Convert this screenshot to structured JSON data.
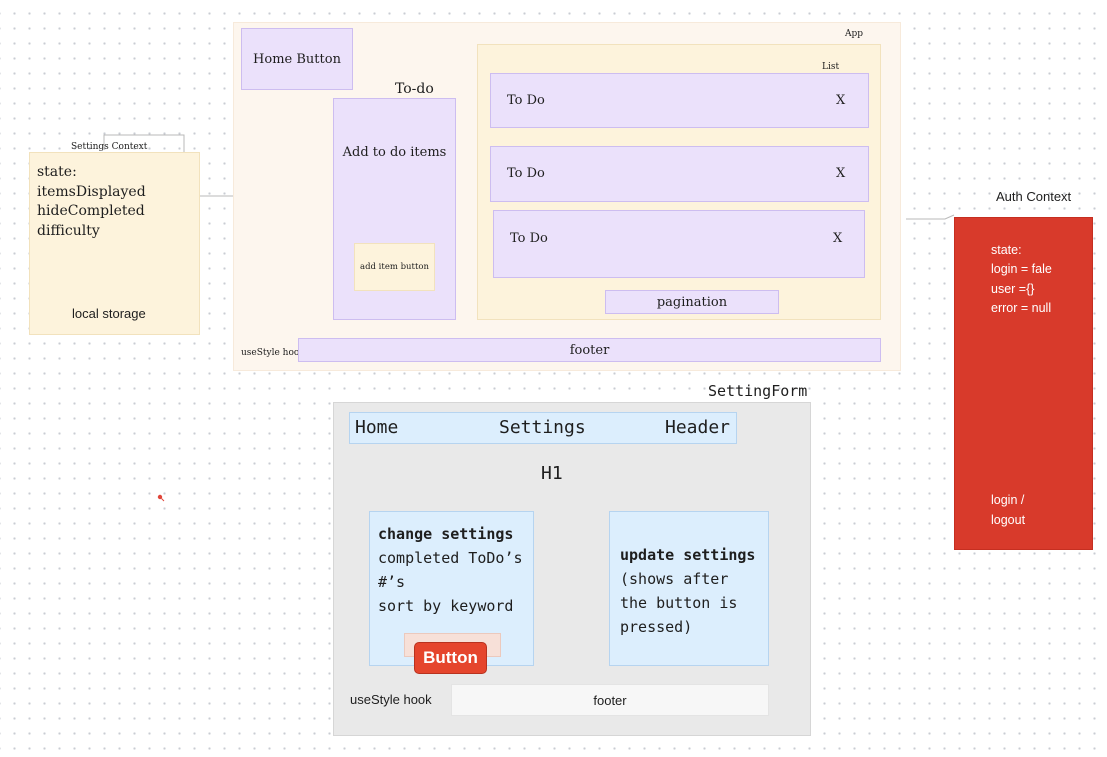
{
  "settings_context": {
    "label": "Settings Context",
    "state_lines": [
      "state:",
      "itemsDisplayed",
      "hideCompleted",
      "difficulty"
    ],
    "storage": "local storage"
  },
  "app": {
    "label": "App",
    "home_button": "Home Button",
    "todo_title": "To-do",
    "add_items": "Add to do items",
    "add_item_button": "add item button",
    "list_label": "List",
    "todos": [
      {
        "text": "To Do",
        "close": "X"
      },
      {
        "text": "To Do",
        "close": "X"
      },
      {
        "text": "To Do",
        "close": "X"
      }
    ],
    "pagination": "pagination",
    "use_style": "useStyle hook",
    "footer": "footer"
  },
  "auth_context": {
    "label": "Auth Context",
    "state_lines": [
      "state:",
      "login = fale",
      "user ={}",
      "error = null"
    ],
    "action_lines": [
      "login /",
      "logout"
    ]
  },
  "setting_form": {
    "label": "SettingForm",
    "header": {
      "home": "Home",
      "settings": "Settings",
      "header": "Header"
    },
    "h1": "H1",
    "change_title": "change settings",
    "change_lines": [
      "completed ToDo’s",
      "#’s",
      "sort by keyword"
    ],
    "button": "Button",
    "update_title": "update settings",
    "update_lines": [
      "(shows after",
      "the button is",
      "pressed)"
    ],
    "use_style": "useStyle hook",
    "footer": "footer"
  },
  "colors": {
    "lavender": "#ebe1fb",
    "cream": "#fdf3dc",
    "app_bg": "#fdf6ee",
    "light_blue": "#dceefd",
    "red": "#d83a2b",
    "button_red": "#e5452d",
    "form_gray": "#e9e9e9"
  }
}
